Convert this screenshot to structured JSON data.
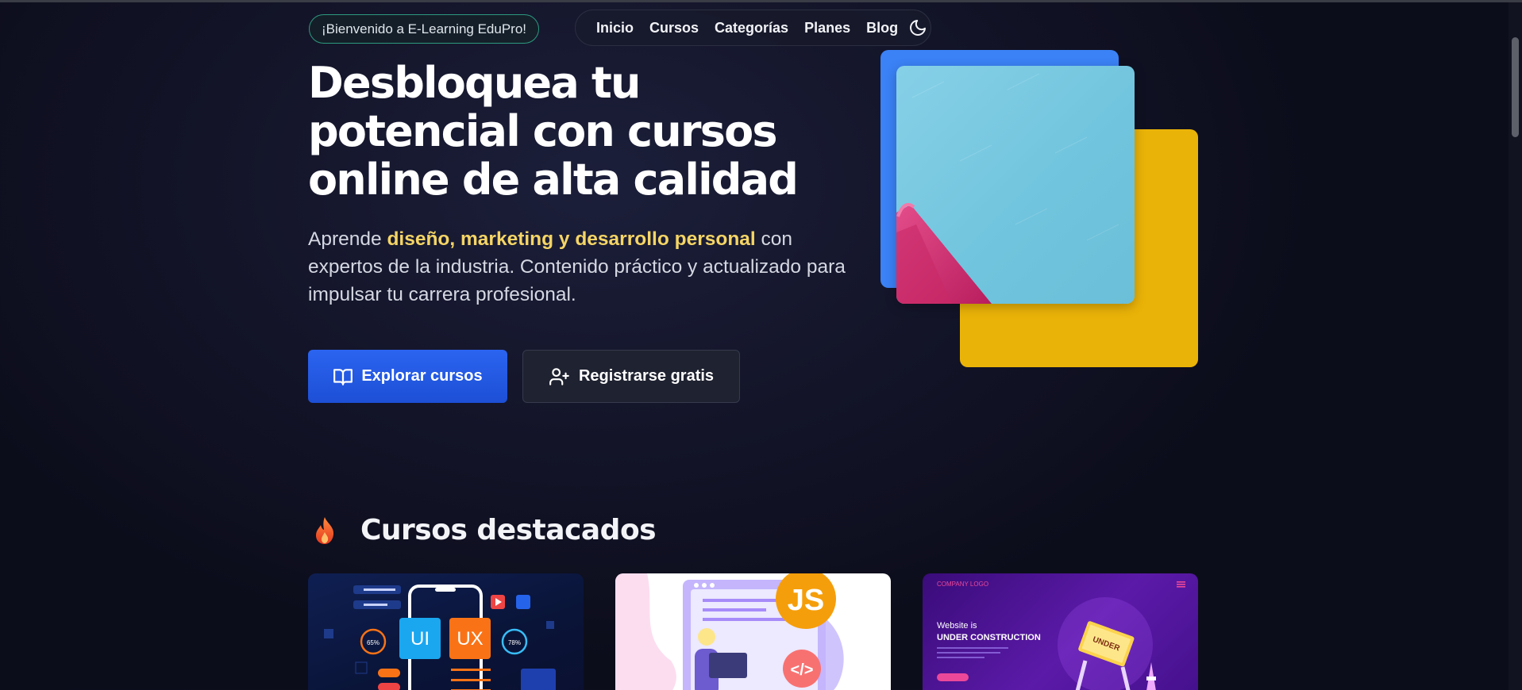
{
  "header": {
    "welcome": "¡Bienvenido a E-Learning EduPro!",
    "nav": [
      "Inicio",
      "Cursos",
      "Categorías",
      "Planes",
      "Blog"
    ],
    "theme_icon": "moon-icon"
  },
  "hero": {
    "title": "Desbloquea tu potencial con cursos online de alta calidad",
    "desc_prefix": "Aprende ",
    "desc_highlight": "diseño, marketing y desarrollo personal",
    "desc_suffix": " con expertos de la industria. Contenido práctico y actualizado para impulsar tu carrera profesional.",
    "primary_button": "Explorar cursos",
    "secondary_button": "Registrarse gratis",
    "primary_icon": "book-open-icon",
    "secondary_icon": "user-plus-icon"
  },
  "featured": {
    "icon": "fire-icon",
    "title": "Cursos destacados",
    "cards": [
      {
        "image_text_1": "UI",
        "image_text_2": "UX",
        "stat_1": "65%",
        "stat_2": "78%"
      },
      {
        "image_text_1": "JS",
        "image_text_2": "</>"
      },
      {
        "image_text_1": "COMPANY LOGO",
        "image_text_2": "Website is",
        "image_text_3": "UNDER CONSTRUCTION",
        "image_text_4": "UNDER"
      }
    ]
  },
  "colors": {
    "accent_blue": "#2b64f0",
    "highlight_yellow": "#f5d565",
    "block_blue": "#3b82f6",
    "block_yellow": "#eab308",
    "pill_border": "#2c9a7f"
  }
}
